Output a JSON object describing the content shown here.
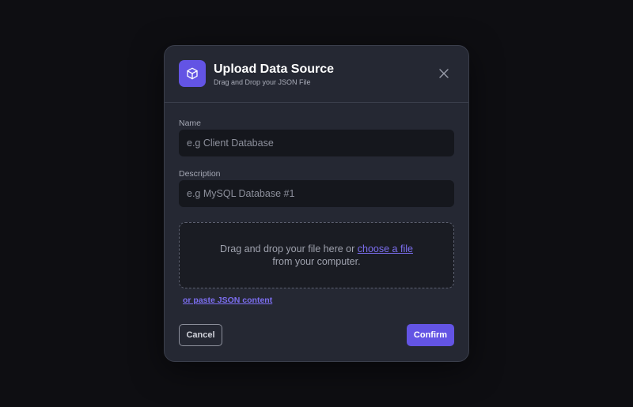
{
  "modal": {
    "title": "Upload Data Source",
    "subtitle": "Drag and Drop your JSON File",
    "logo_icon": "cube-icon",
    "close_icon": "close-icon"
  },
  "form": {
    "name_label": "Name",
    "name_placeholder": "e.g Client Database",
    "name_value": "",
    "description_label": "Description",
    "description_placeholder": "e.g MySQL Database #1",
    "description_value": ""
  },
  "dropzone": {
    "text_before": "Drag and drop your file here or ",
    "link_text": "choose a file ",
    "text_after": "from your computer."
  },
  "paste_link": "or paste JSON content",
  "buttons": {
    "cancel": "Cancel",
    "confirm": "Confirm"
  },
  "colors": {
    "accent": "#6354e4",
    "link": "#7c6ef0",
    "modal_bg": "#252833",
    "page_bg": "#0e0e12"
  }
}
